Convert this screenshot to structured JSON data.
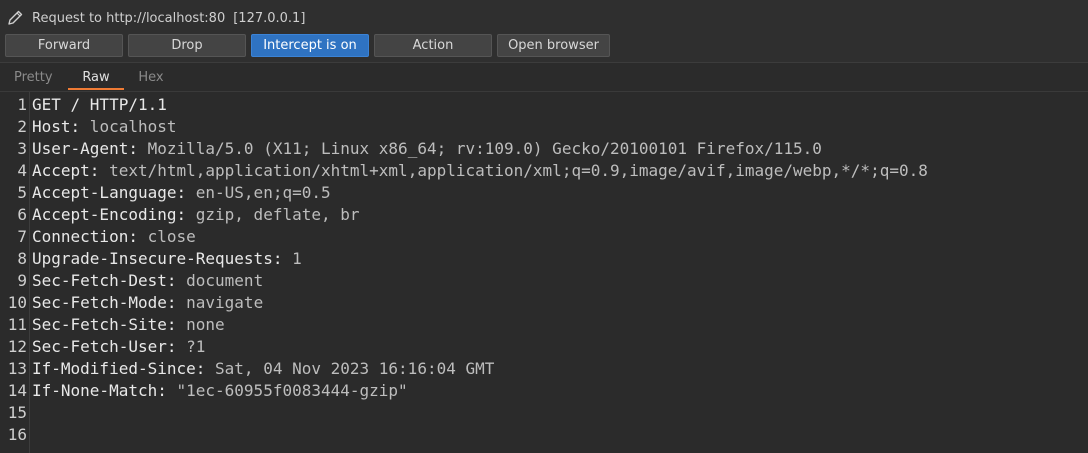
{
  "header": {
    "request_label": "Request to http://localhost:80",
    "ip_label": "[127.0.0.1]"
  },
  "buttons": {
    "forward": "Forward",
    "drop": "Drop",
    "intercept": "Intercept is on",
    "action": "Action",
    "open_browser": "Open browser"
  },
  "tabs": {
    "pretty": "Pretty",
    "raw": "Raw",
    "hex": "Hex"
  },
  "colors": {
    "accent_button": "#2f73c2",
    "tab_underline": "#ef7b35"
  },
  "icons": {
    "edit": "pencil-icon"
  },
  "lines": [
    {
      "num": "1",
      "name": "GET / HTTP/1.1",
      "value": ""
    },
    {
      "num": "2",
      "name": "Host:",
      "value": " localhost"
    },
    {
      "num": "3",
      "name": "User-Agent:",
      "value": " Mozilla/5.0 (X11; Linux x86_64; rv:109.0) Gecko/20100101 Firefox/115.0"
    },
    {
      "num": "4",
      "name": "Accept:",
      "value": " text/html,application/xhtml+xml,application/xml;q=0.9,image/avif,image/webp,*/*;q=0.8"
    },
    {
      "num": "5",
      "name": "Accept-Language:",
      "value": " en-US,en;q=0.5"
    },
    {
      "num": "6",
      "name": "Accept-Encoding:",
      "value": " gzip, deflate, br"
    },
    {
      "num": "7",
      "name": "Connection:",
      "value": " close"
    },
    {
      "num": "8",
      "name": "Upgrade-Insecure-Requests:",
      "value": " 1"
    },
    {
      "num": "9",
      "name": "Sec-Fetch-Dest:",
      "value": " document"
    },
    {
      "num": "10",
      "name": "Sec-Fetch-Mode:",
      "value": " navigate"
    },
    {
      "num": "11",
      "name": "Sec-Fetch-Site:",
      "value": " none"
    },
    {
      "num": "12",
      "name": "Sec-Fetch-User:",
      "value": " ?1"
    },
    {
      "num": "13",
      "name": "If-Modified-Since:",
      "value": " Sat, 04 Nov 2023 16:16:04 GMT"
    },
    {
      "num": "14",
      "name": "If-None-Match:",
      "value": " \"1ec-60955f0083444-gzip\""
    },
    {
      "num": "15",
      "name": "",
      "value": ""
    },
    {
      "num": "16",
      "name": "",
      "value": ""
    }
  ]
}
